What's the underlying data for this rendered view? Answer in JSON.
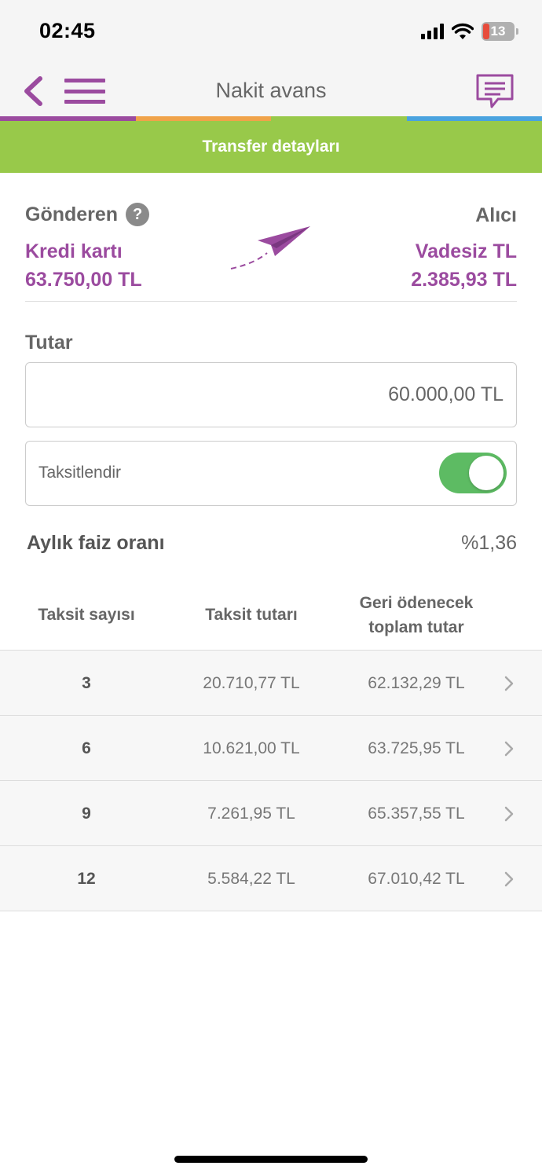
{
  "status_bar": {
    "time": "02:45",
    "battery": "13",
    "icons": [
      "signal-icon",
      "wifi-icon",
      "battery-icon"
    ]
  },
  "nav": {
    "title": "Nakit avans",
    "icons": [
      "back-chevron-icon",
      "menu-icon",
      "chat-icon"
    ]
  },
  "colors": {
    "brand_purple": "#9b4b9f",
    "strip": [
      "#9b4b9f",
      "#f0a34a",
      "#98c94a",
      "#4aa3df"
    ],
    "banner_green": "#98c94a",
    "toggle_green": "#5dbb63"
  },
  "banner": {
    "text": "Transfer detayları"
  },
  "transfer": {
    "sender_label": "Gönderen",
    "help_glyph": "?",
    "sender_name": "Kredi kartı",
    "sender_amount": "63.750,00 TL",
    "receiver_label": "Alıcı",
    "receiver_name": "Vadesiz TL",
    "receiver_amount": "2.385,93 TL"
  },
  "amount": {
    "label": "Tutar",
    "value": "60.000,00 TL"
  },
  "installment": {
    "label": "Taksitlendir",
    "enabled": true
  },
  "rate": {
    "label": "Aylık faiz oranı",
    "value": "%1,36"
  },
  "table": {
    "headers": {
      "count": "Taksit sayısı",
      "monthly": "Taksit tutarı",
      "total_line1": "Geri ödenecek",
      "total_line2": "toplam tutar"
    },
    "rows": [
      {
        "count": "3",
        "monthly": "20.710,77 TL",
        "total": "62.132,29 TL"
      },
      {
        "count": "6",
        "monthly": "10.621,00 TL",
        "total": "63.725,95 TL"
      },
      {
        "count": "9",
        "monthly": "7.261,95 TL",
        "total": "65.357,55 TL"
      },
      {
        "count": "12",
        "monthly": "5.584,22 TL",
        "total": "67.010,42 TL"
      }
    ]
  }
}
